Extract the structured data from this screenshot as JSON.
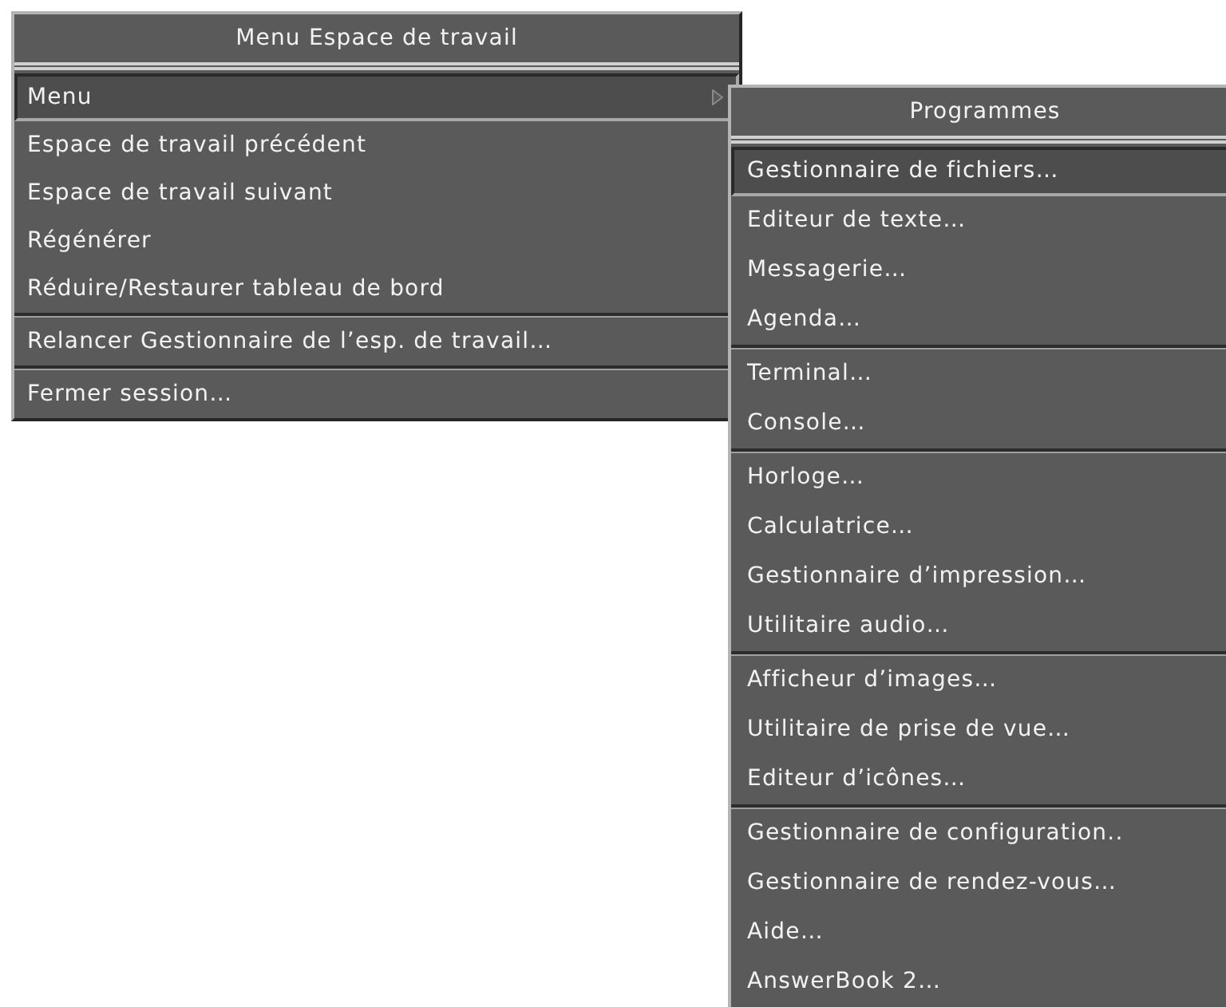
{
  "menus": [
    {
      "title": "Menu Espace de travail",
      "groups": [
        [
          {
            "label": "Menu",
            "selected": true,
            "submenu": true
          },
          {
            "label": "Espace de travail précédent",
            "selected": false,
            "submenu": false
          },
          {
            "label": "Espace de travail suivant",
            "selected": false,
            "submenu": false
          },
          {
            "label": "Régénérer",
            "selected": false,
            "submenu": false
          },
          {
            "label": "Réduire/Restaurer tableau de bord",
            "selected": false,
            "submenu": false
          }
        ],
        [
          {
            "label": "Relancer Gestionnaire de l’esp. de travail…",
            "selected": false,
            "submenu": false
          }
        ],
        [
          {
            "label": "Fermer session…",
            "selected": false,
            "submenu": false
          }
        ]
      ]
    },
    {
      "title": "Programmes",
      "groups": [
        [
          {
            "label": "Gestionnaire de fichiers…",
            "selected": true,
            "submenu": false
          },
          {
            "label": "Editeur de texte…",
            "selected": false,
            "submenu": false
          },
          {
            "label": "Messagerie…",
            "selected": false,
            "submenu": false
          },
          {
            "label": "Agenda…",
            "selected": false,
            "submenu": false
          }
        ],
        [
          {
            "label": "Terminal…",
            "selected": false,
            "submenu": false
          },
          {
            "label": "Console…",
            "selected": false,
            "submenu": false
          }
        ],
        [
          {
            "label": "Horloge…",
            "selected": false,
            "submenu": false
          },
          {
            "label": "Calculatrice…",
            "selected": false,
            "submenu": false
          },
          {
            "label": "Gestionnaire d’impression…",
            "selected": false,
            "submenu": false
          },
          {
            "label": "Utilitaire audio…",
            "selected": false,
            "submenu": false
          }
        ],
        [
          {
            "label": "Afficheur d’images…",
            "selected": false,
            "submenu": false
          },
          {
            "label": "Utilitaire de prise de vue…",
            "selected": false,
            "submenu": false
          },
          {
            "label": "Editeur d’icônes…",
            "selected": false,
            "submenu": false
          }
        ],
        [
          {
            "label": "Gestionnaire de configuration..",
            "selected": false,
            "submenu": false
          },
          {
            "label": "Gestionnaire de rendez-vous…",
            "selected": false,
            "submenu": false
          },
          {
            "label": "Aide…",
            "selected": false,
            "submenu": false
          },
          {
            "label": "AnswerBook 2…",
            "selected": false,
            "submenu": false
          }
        ]
      ]
    }
  ]
}
